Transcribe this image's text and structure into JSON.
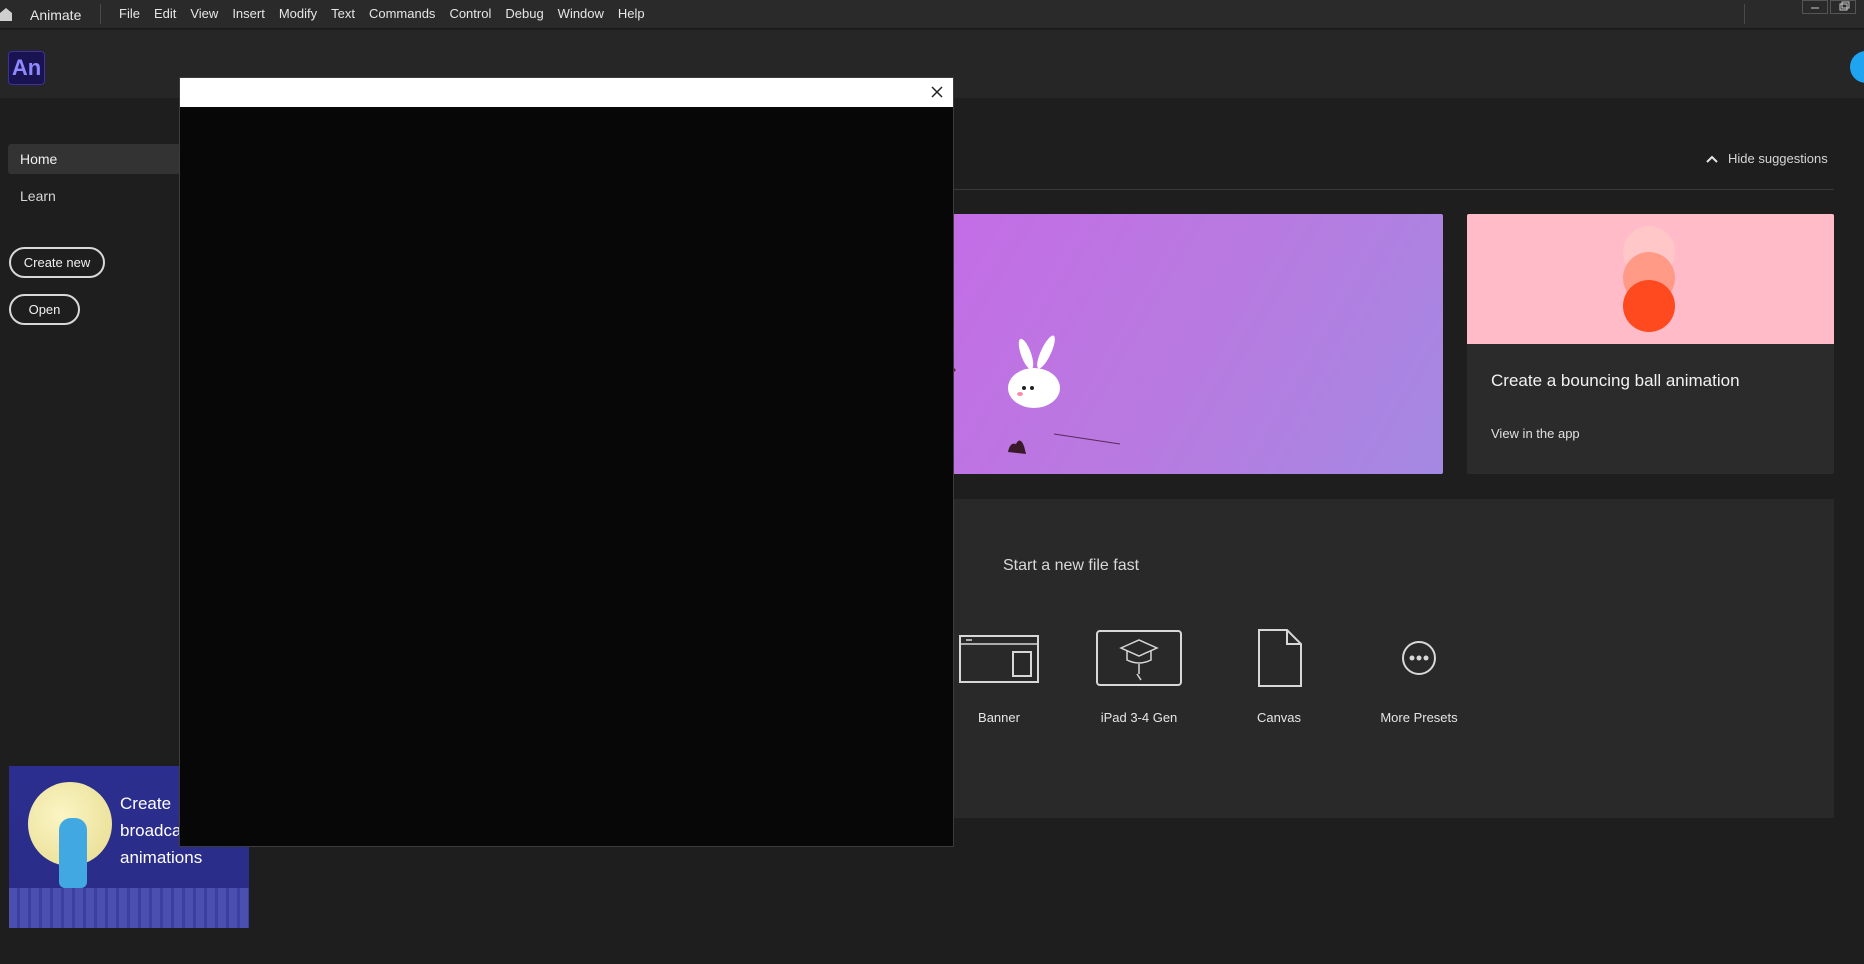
{
  "app": {
    "name": "Animate",
    "logo_text": "An"
  },
  "menu": {
    "items": [
      "File",
      "Edit",
      "View",
      "Insert",
      "Modify",
      "Text",
      "Commands",
      "Control",
      "Debug",
      "Window",
      "Help"
    ]
  },
  "sidebar": {
    "nav": [
      {
        "label": "Home",
        "selected": true
      },
      {
        "label": "Learn",
        "selected": false
      }
    ],
    "create_new_label": "Create new",
    "open_label": "Open",
    "promo_lines": [
      "Create",
      "broadca",
      "animations"
    ]
  },
  "suggestions": {
    "hide_label": "Hide suggestions",
    "card_title": "Create a bouncing ball animation",
    "card_link": "View in the app"
  },
  "quick_start": {
    "title": "Start a new file fast",
    "presets": [
      {
        "label": "Banner",
        "icon": "banner-icon"
      },
      {
        "label": "iPad 3-4 Gen",
        "icon": "ipad-graduation-icon"
      },
      {
        "label": "Canvas",
        "icon": "document-icon"
      },
      {
        "label": "More Presets",
        "icon": "more-icon"
      }
    ]
  },
  "colors": {
    "accent_user": "#1fa4f1",
    "logo_bg": "#1a1352",
    "ball": "#ff4a1f",
    "card_pink": "#ffbcc8"
  }
}
